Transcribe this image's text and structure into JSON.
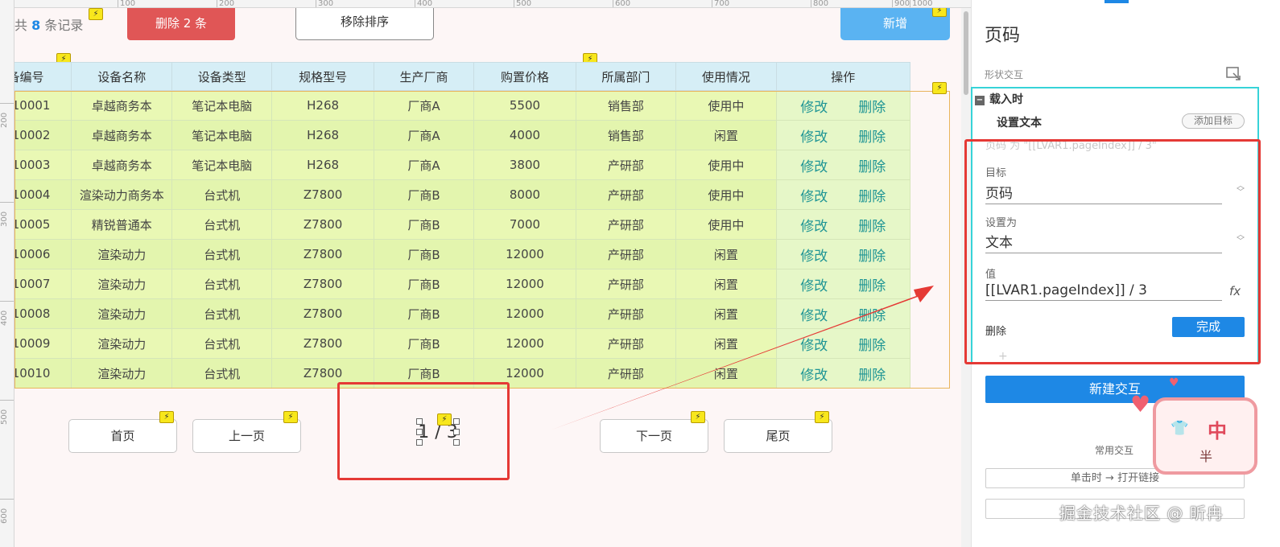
{
  "ruler": {
    "top": [
      "100",
      "200",
      "300",
      "400",
      "500",
      "600",
      "700",
      "800",
      "900",
      "1000"
    ],
    "left": [
      "200",
      "300",
      "400",
      "500",
      "600"
    ]
  },
  "toolbar": {
    "record_prefix": "共",
    "record_count": "8",
    "record_suffix": "条记录",
    "delete_label": "删除 2 条",
    "sort_label": "移除排序",
    "add_label": "新增"
  },
  "table": {
    "headers": [
      "备编号",
      "设备名称",
      "设备类型",
      "规格型号",
      "生产厂商",
      "购置价格",
      "所属部门",
      "使用情况",
      "操作"
    ],
    "edit_label": "修改",
    "delete_label": "删除",
    "rows": [
      [
        "10001",
        "卓越商务本",
        "笔记本电脑",
        "H268",
        "厂商A",
        "5500",
        "销售部",
        "使用中"
      ],
      [
        "10002",
        "卓越商务本",
        "笔记本电脑",
        "H268",
        "厂商A",
        "4000",
        "销售部",
        "闲置"
      ],
      [
        "10003",
        "卓越商务本",
        "笔记本电脑",
        "H268",
        "厂商A",
        "3800",
        "产研部",
        "使用中"
      ],
      [
        "10004",
        "渲染动力商务本",
        "台式机",
        "Z7800",
        "厂商B",
        "8000",
        "产研部",
        "使用中"
      ],
      [
        "10005",
        "精锐普通本",
        "台式机",
        "Z7800",
        "厂商B",
        "7000",
        "产研部",
        "使用中"
      ],
      [
        "10006",
        "渲染动力",
        "台式机",
        "Z7800",
        "厂商B",
        "12000",
        "产研部",
        "闲置"
      ],
      [
        "10007",
        "渲染动力",
        "台式机",
        "Z7800",
        "厂商B",
        "12000",
        "产研部",
        "闲置"
      ],
      [
        "10008",
        "渲染动力",
        "台式机",
        "Z7800",
        "厂商B",
        "12000",
        "产研部",
        "闲置"
      ],
      [
        "10009",
        "渲染动力",
        "台式机",
        "Z7800",
        "厂商B",
        "12000",
        "产研部",
        "闲置"
      ],
      [
        "10010",
        "渲染动力",
        "台式机",
        "Z7800",
        "厂商B",
        "12000",
        "产研部",
        "闲置"
      ]
    ]
  },
  "pager": {
    "first": "首页",
    "prev": "上一页",
    "page_text": "1 / 3",
    "next": "下一页",
    "last": "尾页"
  },
  "bolt_glyph": "⚡",
  "panel": {
    "title": "页码",
    "shape_interaction": "形状交互",
    "event": "载入时",
    "event_toggle": "−",
    "action": "设置文本",
    "add_target": "添加目标",
    "summary": "页码 为 \"[[LVAR1.pageIndex]] / 3\"",
    "target_label": "目标",
    "target_value": "页码",
    "set_as_label": "设置为",
    "set_as_value": "文本",
    "value_label": "值",
    "value_value": "[[LVAR1.pageIndex]] / 3",
    "fx": "fx",
    "delete": "删除",
    "done": "完成",
    "plus": "+",
    "new_interaction": "新建交互",
    "common_label": "常用交互",
    "common_1": "单击时 → 打开链接",
    "common_2": ""
  },
  "sticker": {
    "char1": "中",
    "char2": "半"
  },
  "watermark": "掘金技术社区 @ 昕冉",
  "colors": {
    "accent": "#1e88e5",
    "danger": "#e05656",
    "highlight_red": "#e53935",
    "selection_cyan": "#37d3d8"
  }
}
